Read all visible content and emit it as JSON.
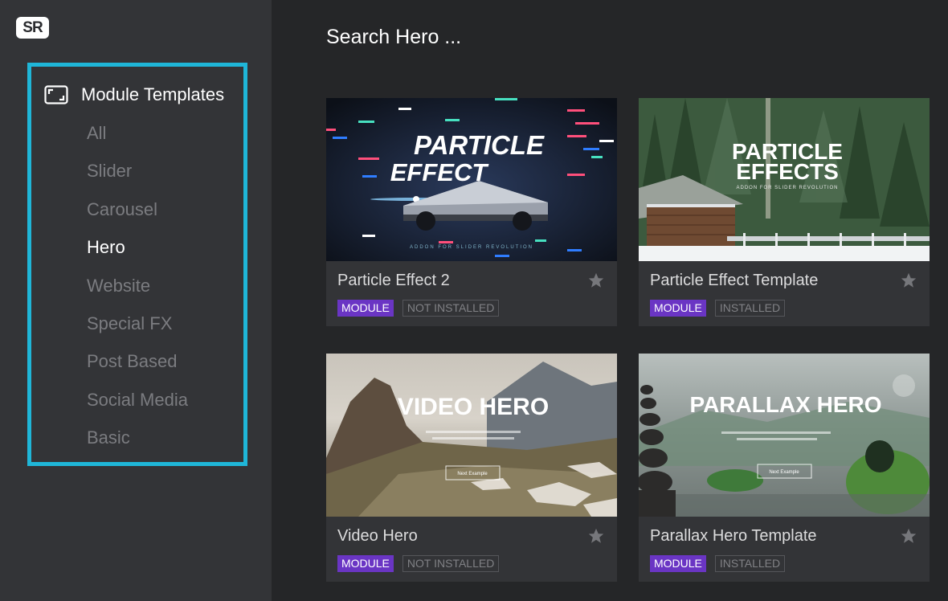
{
  "app": {
    "logo": "SR"
  },
  "sidebar": {
    "header": "Module Templates",
    "items": [
      {
        "label": "All",
        "active": false
      },
      {
        "label": "Slider",
        "active": false
      },
      {
        "label": "Carousel",
        "active": false
      },
      {
        "label": "Hero",
        "active": true
      },
      {
        "label": "Website",
        "active": false
      },
      {
        "label": "Special FX",
        "active": false
      },
      {
        "label": "Post Based",
        "active": false
      },
      {
        "label": "Social Media",
        "active": false
      },
      {
        "label": "Basic",
        "active": false
      }
    ]
  },
  "search": {
    "placeholder": "Search Hero ..."
  },
  "cards": [
    {
      "title": "Particle Effect 2",
      "tag": "MODULE",
      "status": "NOT INSTALLED",
      "thumb": {
        "line1": "PARTICLE",
        "line2": "EFFECT",
        "sub": "ADDON FOR SLIDER REVOLUTION"
      }
    },
    {
      "title": "Particle Effect Template",
      "tag": "MODULE",
      "status": "INSTALLED",
      "thumb": {
        "line1": "PARTICLE",
        "line2": "EFFECTS",
        "sub": "ADDON FOR SLIDER REVOLUTION"
      }
    },
    {
      "title": "Video Hero",
      "tag": "MODULE",
      "status": "NOT INSTALLED",
      "thumb": {
        "line1": "VIDEO HERO",
        "button": "Next Example"
      }
    },
    {
      "title": "Parallax Hero Template",
      "tag": "MODULE",
      "status": "INSTALLED",
      "thumb": {
        "line1": "PARALLAX HERO",
        "button": "Next Example"
      }
    }
  ],
  "colors": {
    "accent": "#1fb6d8",
    "module_tag": "#6a35c4",
    "sidebar_bg": "#333437",
    "main_bg": "#252628"
  }
}
